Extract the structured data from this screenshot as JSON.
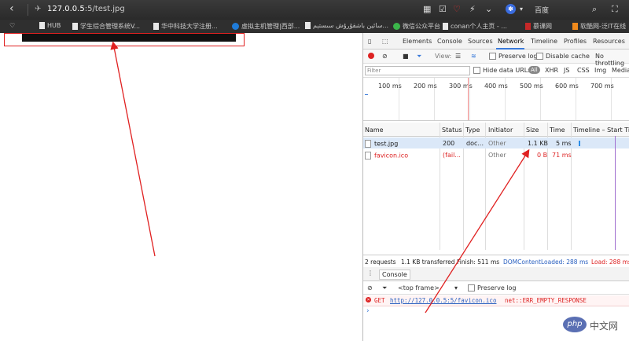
{
  "browser": {
    "url_host": "127.0.0.5",
    "url_path": ":5/test.jpg",
    "search_engine": "百度"
  },
  "bookmarks": [
    {
      "label": "HUB",
      "icon": "page"
    },
    {
      "label": "学生综合管理系统V...",
      "icon": "page"
    },
    {
      "label": "华中科技大学注册...",
      "icon": "page"
    },
    {
      "label": "虚拟主机管理|西部...",
      "icon": "blue"
    },
    {
      "label": "سائين باشقۇرۇش سىستېم...",
      "icon": "page"
    },
    {
      "label": "微信公众平台",
      "icon": "green"
    },
    {
      "label": "conan个人主页 - ...",
      "icon": "page"
    },
    {
      "label": "慕课网",
      "icon": "red"
    },
    {
      "label": "软酷网-泛IT在线",
      "icon": "orange"
    }
  ],
  "devtools": {
    "tabs": [
      "Elements",
      "Console",
      "Sources",
      "Network",
      "Timeline",
      "Profiles",
      "Resources"
    ],
    "active_tab": "Network",
    "toolbar": {
      "view_label": "View:",
      "preserve_log": "Preserve log",
      "disable_cache": "Disable cache",
      "throttling": "No throttling"
    },
    "filter": {
      "placeholder": "Filter",
      "hide_data_urls": "Hide data URLs",
      "types": [
        "All",
        "XHR",
        "JS",
        "CSS",
        "Img",
        "Media"
      ]
    },
    "timeline_ticks": [
      "100 ms",
      "200 ms",
      "300 ms",
      "400 ms",
      "500 ms",
      "600 ms",
      "700 ms"
    ],
    "columns": [
      "Name",
      "Status",
      "Type",
      "Initiator",
      "Size",
      "Time",
      "Timeline – Start Time"
    ],
    "requests": [
      {
        "name": "test.jpg",
        "status": "200",
        "type": "doc...",
        "initiator": "Other",
        "size": "1.1 KB",
        "time": "5 ms",
        "error": false
      },
      {
        "name": "favicon.ico",
        "status": "(fail...",
        "type": "",
        "initiator": "Other",
        "size": "0 B",
        "time": "71 ms",
        "error": true
      }
    ],
    "summary": {
      "requests": "2 requests",
      "transferred": "1.1 KB transferred",
      "finish": "Finish: 511 ms",
      "dcl": "DOMContentLoaded: 288 ms",
      "load": "Load: 288 ms"
    },
    "console": {
      "tab": "Console",
      "frame": "<top frame>",
      "preserve_log": "Preserve log",
      "error_method": "GET",
      "error_url": "http://127.0.0.5:5/favicon.ico",
      "error_msg": "net::ERR_EMPTY_RESPONSE",
      "prompt": "›"
    }
  },
  "watermark": {
    "logo": "php",
    "text": "中文网"
  },
  "colors": {
    "annotation": "#e02020",
    "accent": "#3879d9",
    "error": "#d22222"
  }
}
